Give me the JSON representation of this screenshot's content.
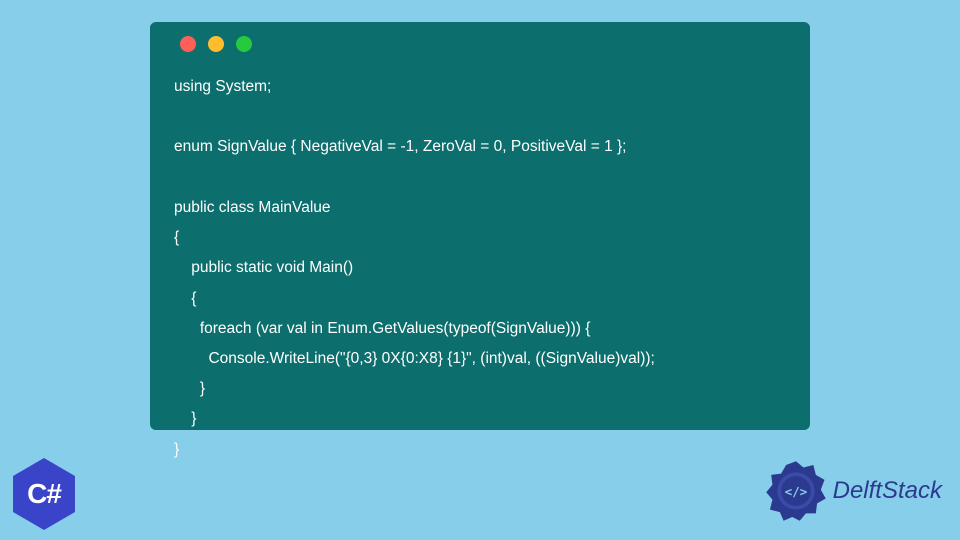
{
  "window": {
    "controls": {
      "red": "#ff5f56",
      "yellow": "#ffbd2e",
      "green": "#27c93f"
    }
  },
  "code": {
    "line1": "using System;",
    "line2": "",
    "line3": "enum SignValue { NegativeVal = -1, ZeroVal = 0, PositiveVal = 1 };",
    "line4": "",
    "line5": "public class MainValue",
    "line6": "{",
    "line7": "    public static void Main()",
    "line8": "    {",
    "line9": "      foreach (var val in Enum.GetValues(typeof(SignValue))) {",
    "line10": "        Console.WriteLine(\"{0,3} 0X{0:X8} {1}\", (int)val, ((SignValue)val));",
    "line11": "      }",
    "line12": "    }",
    "line13": "}"
  },
  "badges": {
    "csharp_label": "C#",
    "delft_label": "DelftStack"
  },
  "colors": {
    "background": "#87ceeb",
    "code_window": "#0d6e6e",
    "code_text": "#ffffff",
    "csharp_badge": "#3a44c8",
    "delft_text": "#2b3a8f",
    "delft_gear": "#2b3a8f"
  }
}
